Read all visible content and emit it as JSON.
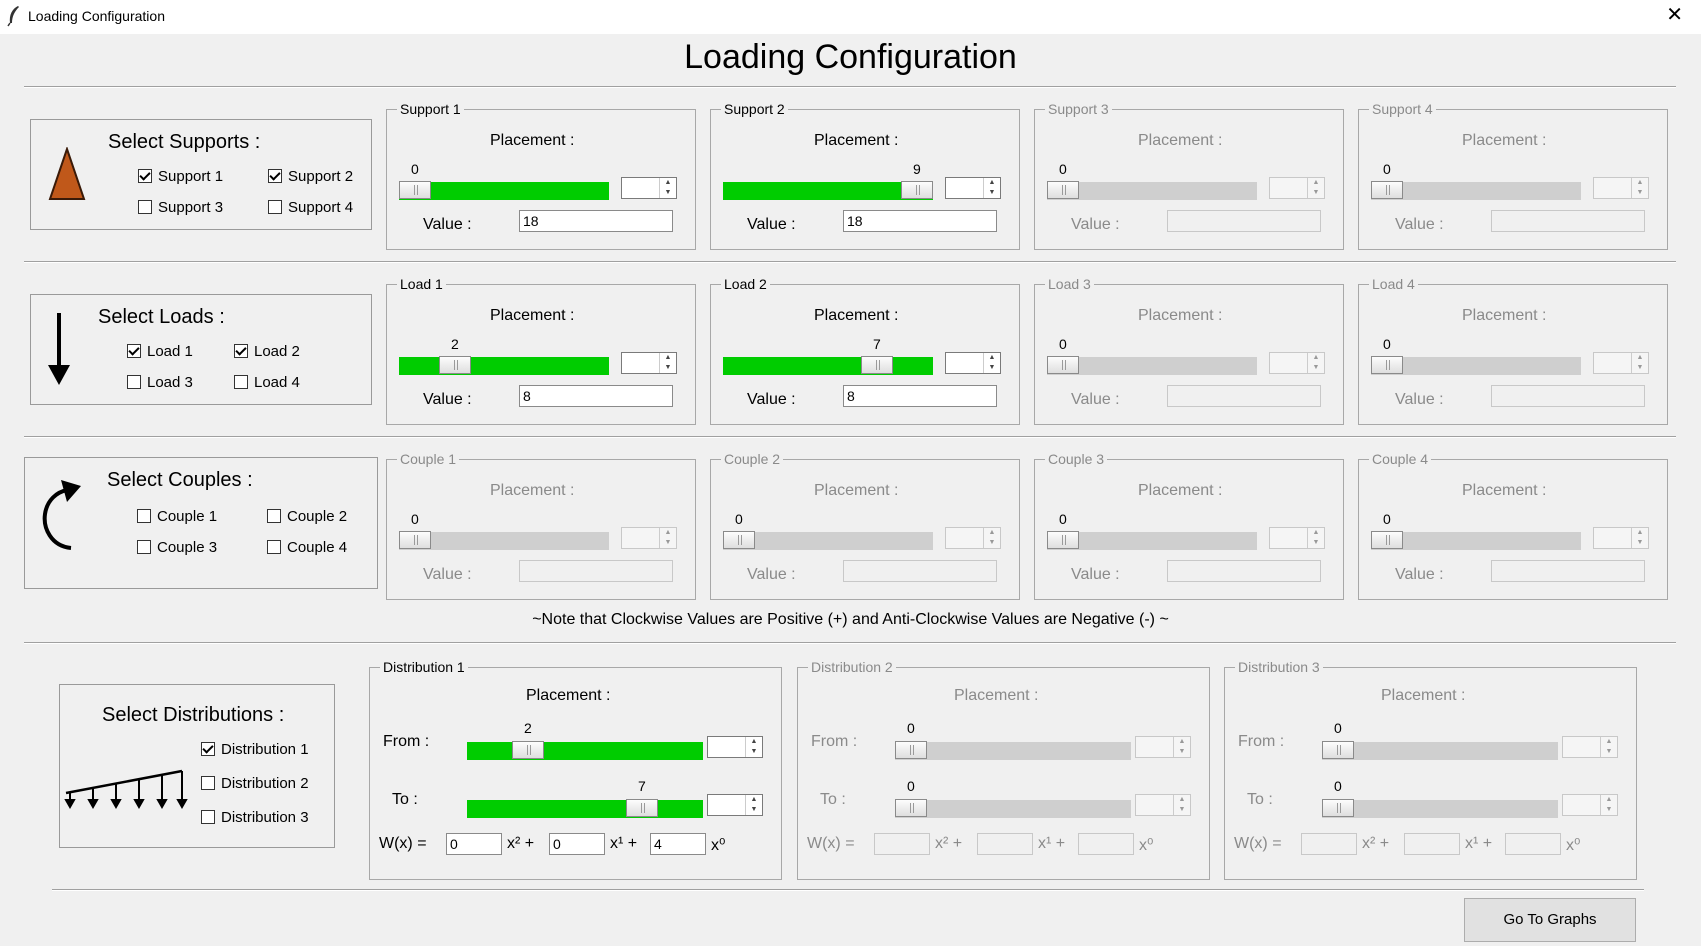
{
  "window": {
    "title": "Loading Configuration",
    "close_glyph": "✕"
  },
  "header": {
    "title": "Loading Configuration"
  },
  "supports": {
    "title": "Select Supports :",
    "checks": [
      {
        "label": "Support 1",
        "checked": true
      },
      {
        "label": "Support 2",
        "checked": true
      },
      {
        "label": "Support 3",
        "checked": false
      },
      {
        "label": "Support 4",
        "checked": false
      }
    ],
    "groups": [
      {
        "legend": "Support 1",
        "placement_label": "Placement :",
        "slider_value": "0",
        "slider_fraction": 0.0,
        "value_label": "Value :",
        "value": "18",
        "enabled": true
      },
      {
        "legend": "Support 2",
        "placement_label": "Placement :",
        "slider_value": "9",
        "slider_fraction": 1.0,
        "value_label": "Value :",
        "value": "18",
        "enabled": true
      },
      {
        "legend": "Support 3",
        "placement_label": "Placement :",
        "slider_value": "0",
        "slider_fraction": 0.0,
        "value_label": "Value :",
        "value": "",
        "enabled": false
      },
      {
        "legend": "Support 4",
        "placement_label": "Placement :",
        "slider_value": "0",
        "slider_fraction": 0.0,
        "value_label": "Value :",
        "value": "",
        "enabled": false
      }
    ]
  },
  "loads": {
    "title": "Select Loads :",
    "checks": [
      {
        "label": "Load 1",
        "checked": true
      },
      {
        "label": "Load 2",
        "checked": true
      },
      {
        "label": "Load 3",
        "checked": false
      },
      {
        "label": "Load 4",
        "checked": false
      }
    ],
    "groups": [
      {
        "legend": "Load 1",
        "placement_label": "Placement :",
        "slider_value": "2",
        "slider_fraction": 0.222,
        "value_label": "Value :",
        "value": "8",
        "enabled": true
      },
      {
        "legend": "Load 2",
        "placement_label": "Placement :",
        "slider_value": "7",
        "slider_fraction": 0.778,
        "value_label": "Value :",
        "value": "8",
        "enabled": true
      },
      {
        "legend": "Load 3",
        "placement_label": "Placement :",
        "slider_value": "0",
        "slider_fraction": 0.0,
        "value_label": "Value :",
        "value": "",
        "enabled": false
      },
      {
        "legend": "Load 4",
        "placement_label": "Placement :",
        "slider_value": "0",
        "slider_fraction": 0.0,
        "value_label": "Value :",
        "value": "",
        "enabled": false
      }
    ]
  },
  "couples": {
    "title": "Select Couples :",
    "checks": [
      {
        "label": "Couple 1",
        "checked": false
      },
      {
        "label": "Couple 2",
        "checked": false
      },
      {
        "label": "Couple 3",
        "checked": false
      },
      {
        "label": "Couple 4",
        "checked": false
      }
    ],
    "groups": [
      {
        "legend": "Couple 1",
        "placement_label": "Placement :",
        "slider_value": "0",
        "slider_fraction": 0.0,
        "value_label": "Value :",
        "value": "",
        "enabled": false
      },
      {
        "legend": "Couple 2",
        "placement_label": "Placement :",
        "slider_value": "0",
        "slider_fraction": 0.0,
        "value_label": "Value :",
        "value": "",
        "enabled": false
      },
      {
        "legend": "Couple 3",
        "placement_label": "Placement :",
        "slider_value": "0",
        "slider_fraction": 0.0,
        "value_label": "Value :",
        "value": "",
        "enabled": false
      },
      {
        "legend": "Couple 4",
        "placement_label": "Placement :",
        "slider_value": "0",
        "slider_fraction": 0.0,
        "value_label": "Value :",
        "value": "",
        "enabled": false
      }
    ]
  },
  "note": "~Note that Clockwise Values are Positive (+) and Anti-Clockwise Values are Negative (-) ~",
  "distributions": {
    "title": "Select Distributions :",
    "checks": [
      {
        "label": "Distribution 1",
        "checked": true
      },
      {
        "label": "Distribution 2",
        "checked": false
      },
      {
        "label": "Distribution 3",
        "checked": false
      }
    ],
    "groups": [
      {
        "legend": "Distribution 1",
        "placement_label": "Placement :",
        "from_label": "From :",
        "to_label": "To :",
        "from_value": "2",
        "from_fraction": 0.222,
        "to_value": "7",
        "to_fraction": 0.778,
        "wx_label": "W(x) =",
        "x2_label": "x² +",
        "x1_label": "x¹ +",
        "x0_label": "x⁰",
        "c2": "0",
        "c1": "0",
        "c0": "4",
        "enabled": true
      },
      {
        "legend": "Distribution 2",
        "placement_label": "Placement :",
        "from_label": "From :",
        "to_label": "To :",
        "from_value": "0",
        "from_fraction": 0.0,
        "to_value": "0",
        "to_fraction": 0.0,
        "wx_label": "W(x) =",
        "x2_label": "x² +",
        "x1_label": "x¹ +",
        "x0_label": "x⁰",
        "c2": "",
        "c1": "",
        "c0": "",
        "enabled": false
      },
      {
        "legend": "Distribution 3",
        "placement_label": "Placement :",
        "from_label": "From :",
        "to_label": "To :",
        "from_value": "0",
        "from_fraction": 0.0,
        "to_value": "0",
        "to_fraction": 0.0,
        "wx_label": "W(x) =",
        "x2_label": "x² +",
        "x1_label": "x¹ +",
        "x0_label": "x⁰",
        "c2": "",
        "c1": "",
        "c0": "",
        "enabled": false
      }
    ]
  },
  "footer": {
    "go_button": "Go To Graphs"
  },
  "colors": {
    "active_track": "#00cc00",
    "inactive_track": "#cfcfcf",
    "support_icon": "#c0581a"
  }
}
